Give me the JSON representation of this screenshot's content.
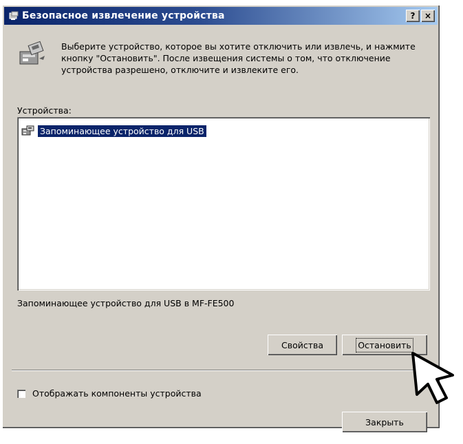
{
  "window": {
    "title": "Безопасное извлечение устройства",
    "help_label": "?",
    "close_label": "×"
  },
  "instruction": {
    "text": "Выберите устройство, которое вы хотите отключить или извлечь, и нажмите кнопку \"Остановить\". После извещения системы о том, что отключение устройства разрешено, отключите и извлеките его."
  },
  "devices": {
    "label": "Устройства:",
    "items": [
      {
        "label": "Запоминающее устройство для USB",
        "selected": true,
        "icon": "usb-storage-icon"
      }
    ]
  },
  "status_line": "Запоминающее устройство для USB в MF-FE500",
  "buttons": {
    "properties": "Свойства",
    "stop": "Остановить",
    "close": "Закрыть"
  },
  "checkbox": {
    "label": "Отображать компоненты устройства",
    "checked": false
  },
  "colors": {
    "title_bar": "#0a246a",
    "dialog_face": "#d4d0c8",
    "selection": "#0a246a"
  }
}
